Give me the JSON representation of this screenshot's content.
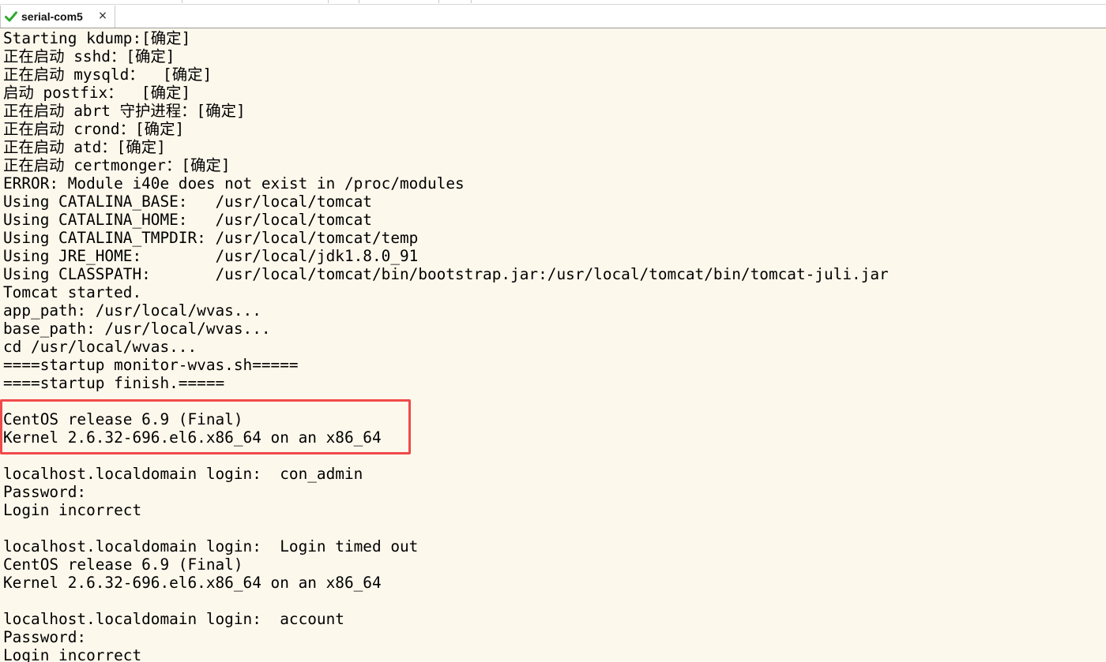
{
  "tab": {
    "label": "serial-com5",
    "status_icon": "check-icon",
    "close_symbol": "×"
  },
  "colors": {
    "terminal_bg": "#fdf8ec",
    "terminal_text": "#000000",
    "highlight_border": "#f04a4a",
    "tab_check": "#2fa82f"
  },
  "terminal": {
    "lines": [
      "Starting kdump:[确定]",
      "正在启动 sshd：[确定]",
      "正在启动 mysqld：  [确定]",
      "启动 postfix：  [确定]",
      "正在启动 abrt 守护进程：[确定]",
      "正在启动 crond：[确定]",
      "正在启动 atd：[确定]",
      "正在启动 certmonger：[确定]",
      "ERROR: Module i40e does not exist in /proc/modules",
      "Using CATALINA_BASE:   /usr/local/tomcat",
      "Using CATALINA_HOME:   /usr/local/tomcat",
      "Using CATALINA_TMPDIR: /usr/local/tomcat/temp",
      "Using JRE_HOME:        /usr/local/jdk1.8.0_91",
      "Using CLASSPATH:       /usr/local/tomcat/bin/bootstrap.jar:/usr/local/tomcat/bin/tomcat-juli.jar",
      "Tomcat started.",
      "app_path: /usr/local/wvas...",
      "base_path: /usr/local/wvas...",
      "cd /usr/local/wvas...",
      "====startup monitor-wvas.sh=====",
      "====startup finish.=====",
      "",
      "CentOS release 6.9 (Final)",
      "Kernel 2.6.32-696.el6.x86_64 on an x86_64",
      "",
      "localhost.localdomain login:  con_admin",
      "Password:",
      "Login incorrect",
      "",
      "localhost.localdomain login:  Login timed out",
      "CentOS release 6.9 (Final)",
      "Kernel 2.6.32-696.el6.x86_64 on an x86_64",
      "",
      "localhost.localdomain login:  account",
      "Password:",
      "Login incorrect"
    ]
  }
}
